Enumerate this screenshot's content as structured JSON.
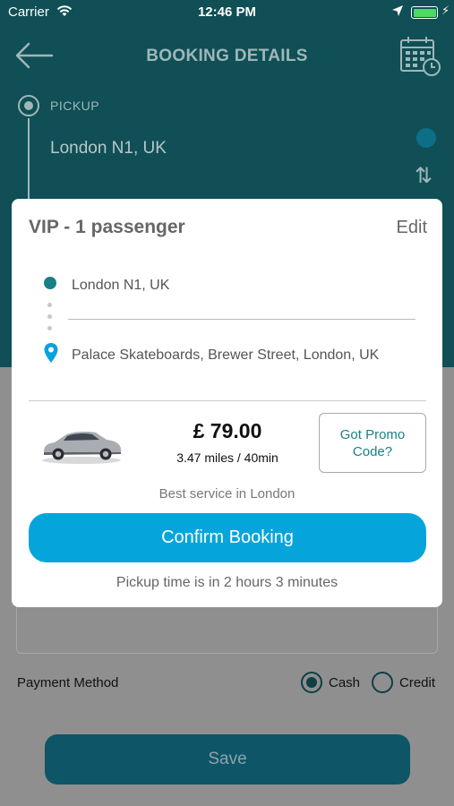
{
  "status_bar": {
    "carrier": "Carrier",
    "time": "12:46 PM"
  },
  "header": {
    "title": "BOOKING DETAILS"
  },
  "route_background": {
    "pickup_label": "PICKUP",
    "pickup_address": "London N1, UK"
  },
  "modal": {
    "vehicle_title": "VIP - 1 passenger",
    "edit_label": "Edit",
    "from_address": "London N1, UK",
    "to_address": "Palace Skateboards, Brewer Street, London, UK",
    "price": "£ 79.00",
    "distance_duration": "3.47 miles / 40min",
    "promo_label": "Got Promo Code?",
    "service_note": "Best service in London",
    "confirm_label": "Confirm Booking",
    "pickup_time_note": "Pickup time is in 2 hours 3 minutes"
  },
  "payment": {
    "label": "Payment Method",
    "options": [
      "Cash",
      "Credit"
    ],
    "selected": "Cash"
  },
  "save_label": "Save",
  "colors": {
    "header_bg": "#0f4f55",
    "accent_teal": "#1a7f87",
    "confirm_blue": "#05a5dc",
    "battery_green": "#4cd964"
  }
}
